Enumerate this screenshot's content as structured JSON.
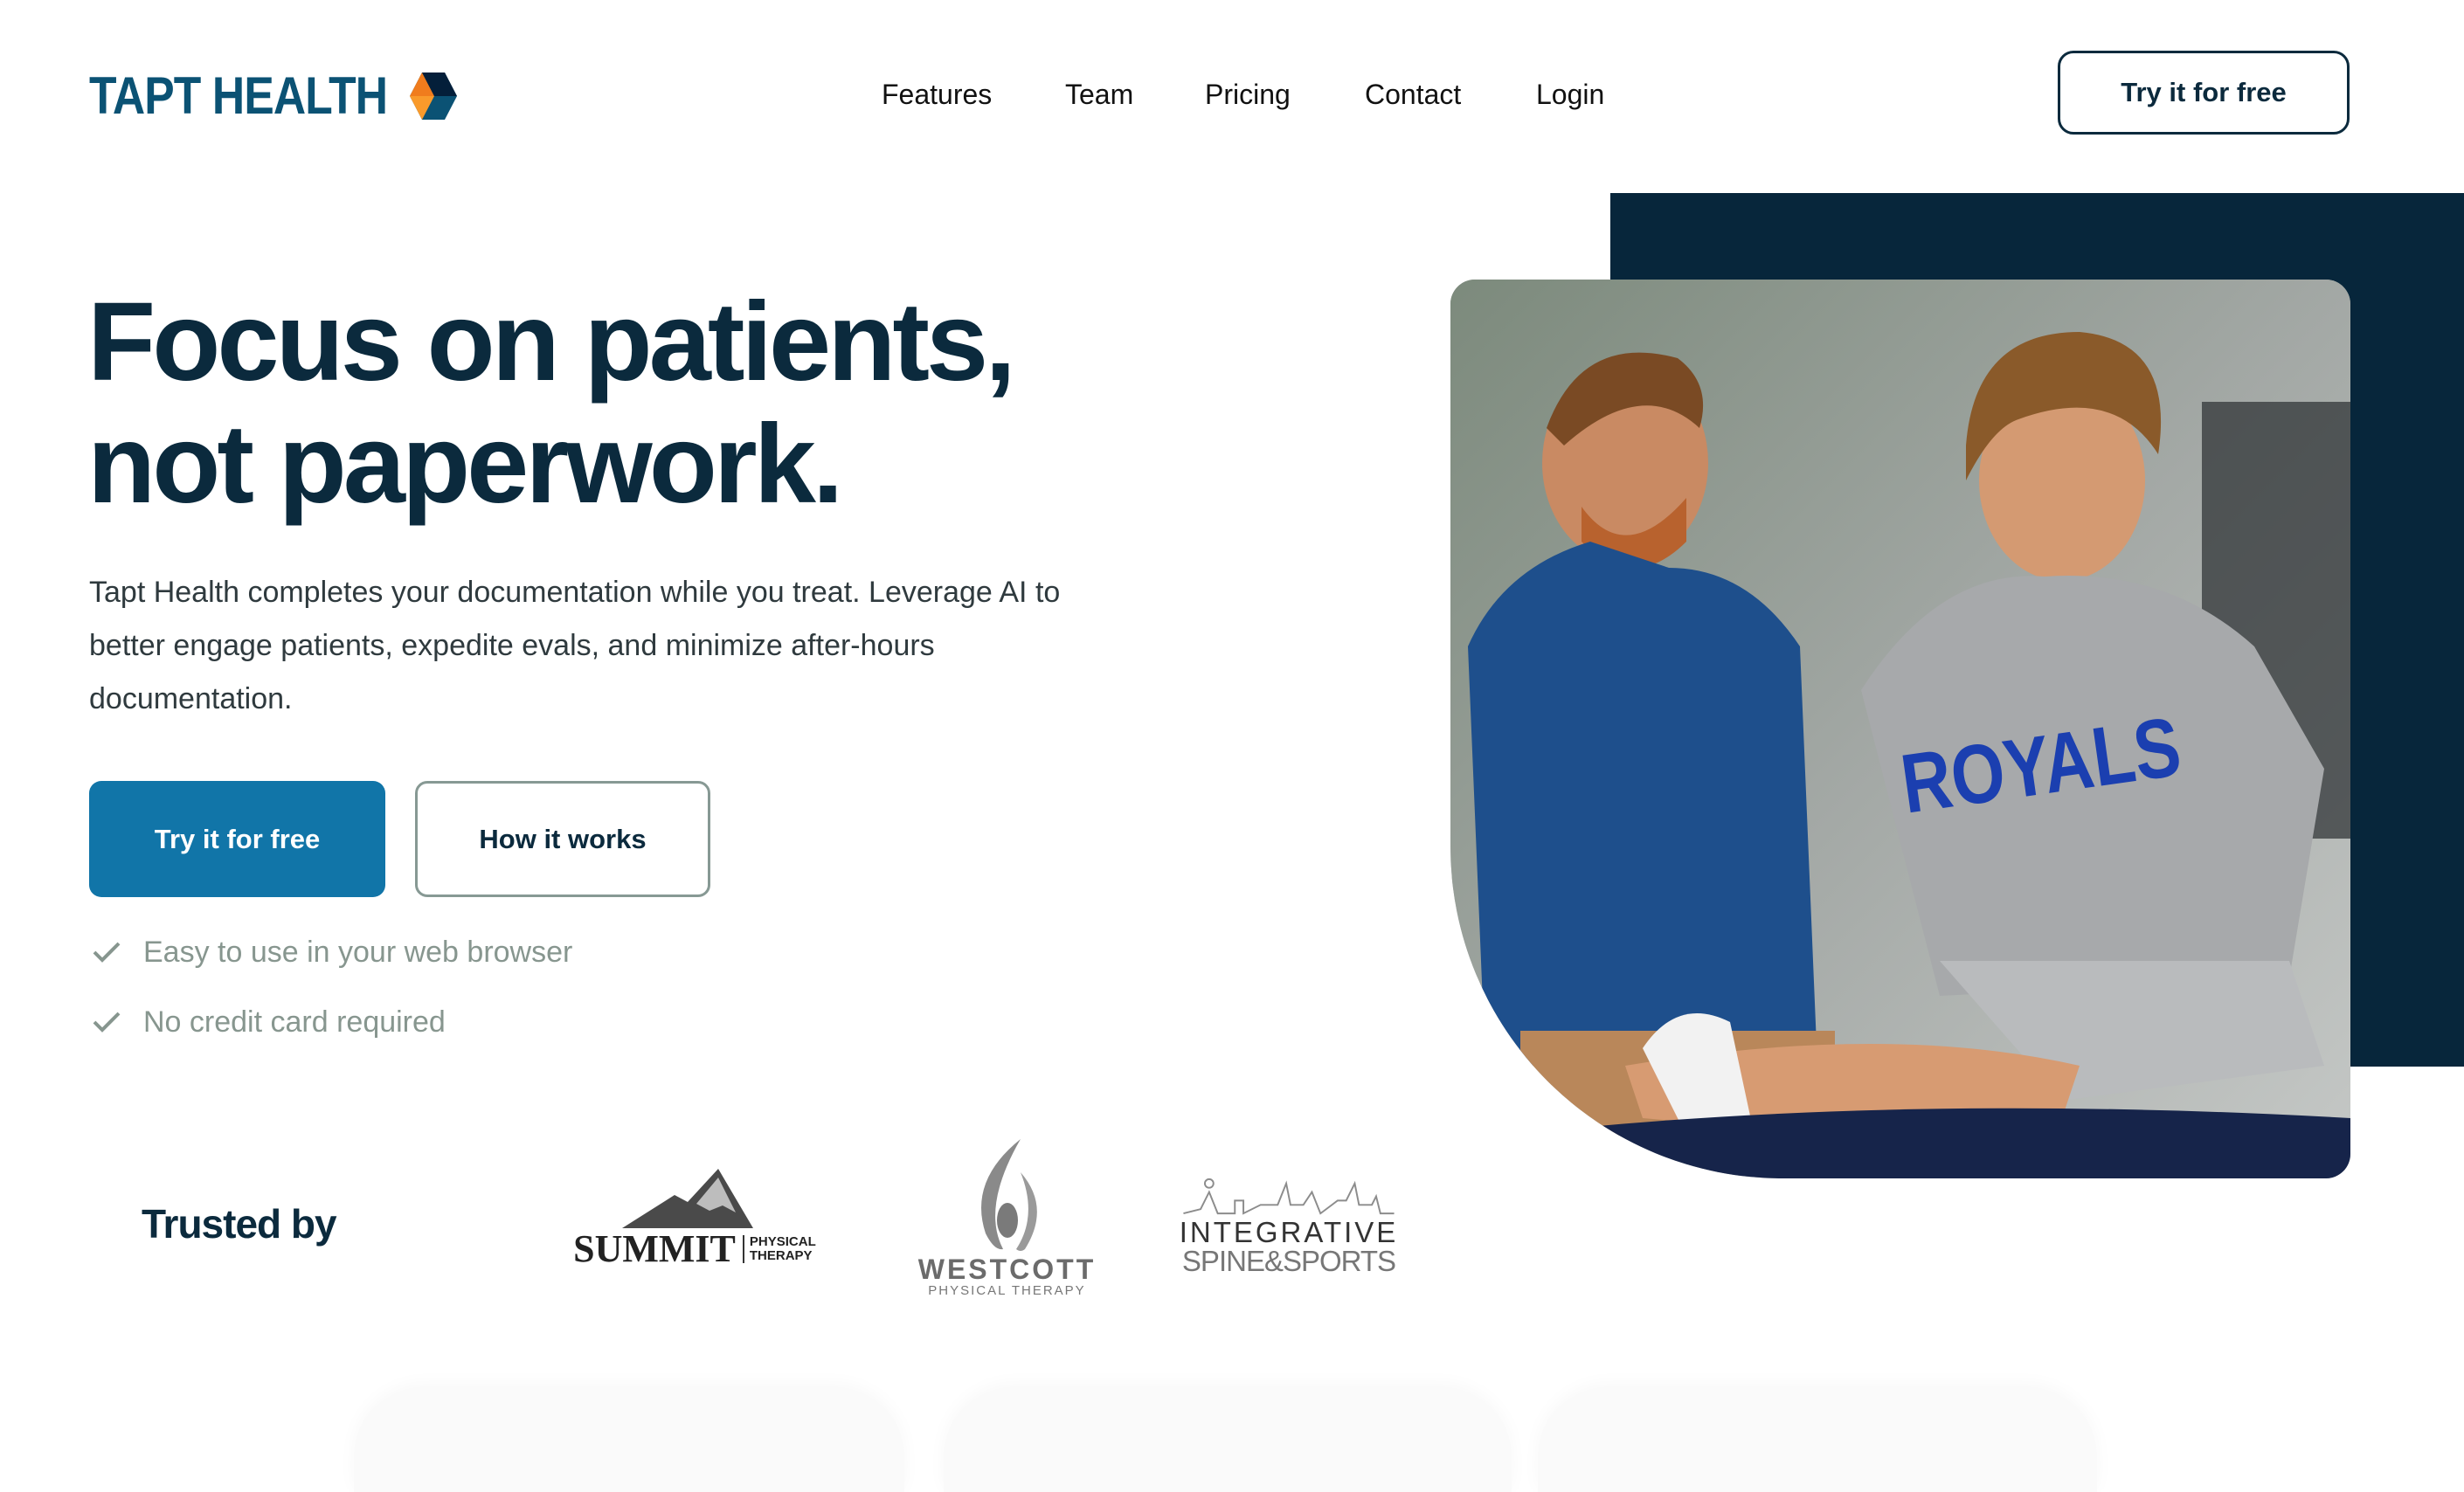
{
  "brand": {
    "name": "TAPT HEALTH",
    "logo_icon": "hexagon-cube-icon",
    "colors": {
      "navy": "#0b2a3d",
      "logo_blue": "#0b5274",
      "accent_blue": "#1175a8",
      "orange": "#f07c1d",
      "orange_light": "#f99a2b",
      "dark_panel": "#07263b",
      "muted_gray": "#87968f"
    }
  },
  "nav": {
    "items": [
      {
        "label": "Features"
      },
      {
        "label": "Team"
      },
      {
        "label": "Pricing"
      },
      {
        "label": "Contact"
      },
      {
        "label": "Login"
      }
    ],
    "cta_label": "Try it for free"
  },
  "hero": {
    "headline_line1": "Focus on patients,",
    "headline_line2": "not paperwork.",
    "description": "Tapt Health completes your documentation while you treat. Leverage AI to better engage patients, expedite evals, and minimize after-hours documentation.",
    "primary_button": "Try it for free",
    "secondary_button": "How it works",
    "checks": [
      {
        "icon": "check-icon",
        "label": "Easy to use in your web browser"
      },
      {
        "icon": "check-icon",
        "label": "No credit card required"
      }
    ],
    "image_alt": "Physical therapist stretching a smiling young athlete wearing a Royals shirt",
    "shirt_text": "ROYALS"
  },
  "trusted": {
    "label": "Trusted by",
    "partners": [
      {
        "name": "SUMMIT",
        "sub": "PHYSICAL THERAPY",
        "icon": "mountain-icon"
      },
      {
        "name": "WESTCOTT",
        "sub": "PHYSICAL THERAPY",
        "icon": "flame-figure-icon"
      },
      {
        "name": "INTEGRATIVE",
        "sub": "SPINE&SPORTS",
        "icon": "runner-skyline-icon"
      }
    ]
  }
}
